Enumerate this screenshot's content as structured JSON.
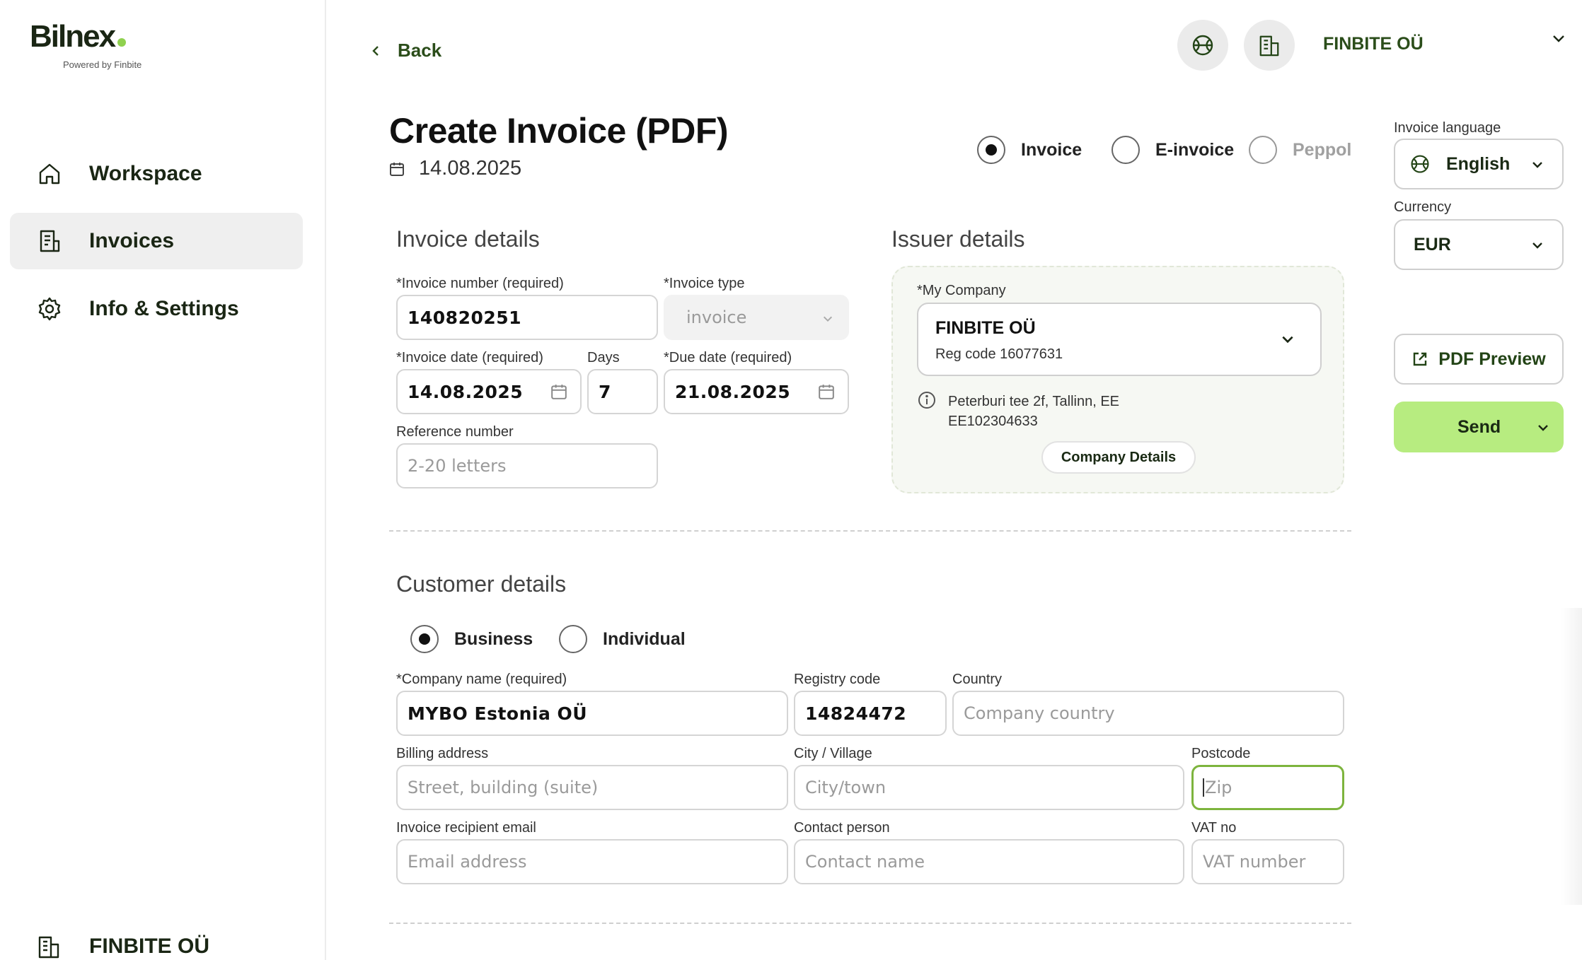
{
  "app": {
    "logo_text": "Bilnex",
    "logo_sub": "Powered by Finbite",
    "accent_color": "#8fd14f",
    "send_color": "#b7ec80"
  },
  "sidebar": {
    "items": [
      {
        "label": "Workspace",
        "icon": "home-icon"
      },
      {
        "label": "Invoices",
        "icon": "invoice-icon",
        "active": true
      },
      {
        "label": "Info & Settings",
        "icon": "gear-icon"
      }
    ],
    "footer_company": "FINBITE OÜ"
  },
  "topbar": {
    "back_label": "Back",
    "company": "FINBITE OÜ"
  },
  "page": {
    "title": "Create Invoice (PDF)",
    "date": "14.08.2025"
  },
  "format": {
    "options": [
      {
        "label": "Invoice",
        "checked": true
      },
      {
        "label": "E-invoice",
        "checked": false
      },
      {
        "label": "Peppol",
        "checked": false,
        "disabled": true
      }
    ]
  },
  "settings": {
    "language_label": "Invoice language",
    "language_value": "English",
    "currency_label": "Currency",
    "currency_value": "EUR",
    "pdf_preview_label": "PDF Preview",
    "send_label": "Send"
  },
  "invoice_details": {
    "title": "Invoice details",
    "number_label": "*Invoice number (required)",
    "number_value": "140820251",
    "type_label": "*Invoice type",
    "type_value": "invoice",
    "date_label": "*Invoice date (required)",
    "date_value": "14.08.2025",
    "days_label": "Days",
    "days_value": "7",
    "due_label": "*Due date (required)",
    "due_value": "21.08.2025",
    "reference_label": "Reference number",
    "reference_placeholder": "2-20 letters"
  },
  "issuer": {
    "title": "Issuer details",
    "company_label": "*My Company",
    "company_name": "FINBITE OÜ",
    "reg_code": "Reg code 16077631",
    "address": "Peterburi tee 2f, Tallinn, EE",
    "vat": "EE102304633",
    "details_button": "Company Details"
  },
  "customer": {
    "title": "Customer details",
    "type_options": [
      {
        "label": "Business",
        "checked": true
      },
      {
        "label": "Individual",
        "checked": false
      }
    ],
    "company_name_label": "*Company name (required)",
    "company_name_value": "MYBO Estonia OÜ",
    "registry_label": "Registry code",
    "registry_value": "14824472",
    "country_label": "Country",
    "country_placeholder": "Company country",
    "billing_label": "Billing address",
    "billing_placeholder": "Street, building (suite)",
    "city_label": "City / Village",
    "city_placeholder": "City/town",
    "postcode_label": "Postcode",
    "postcode_placeholder": "Zip",
    "email_label": "Invoice recipient email",
    "email_placeholder": "Email address",
    "contact_label": "Contact person",
    "contact_placeholder": "Contact name",
    "vat_label": "VAT no",
    "vat_placeholder": "VAT number"
  }
}
